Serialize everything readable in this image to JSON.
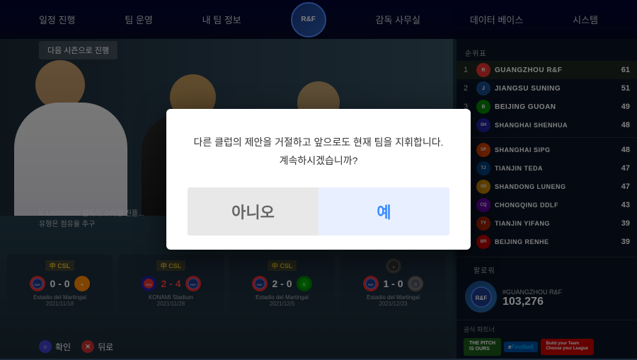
{
  "nav": {
    "items": [
      {
        "id": "schedule",
        "label": "일정 진행",
        "active": false
      },
      {
        "id": "team",
        "label": "팀 운영",
        "active": false
      },
      {
        "id": "team-info",
        "label": "내 팀 정보",
        "active": false
      },
      {
        "id": "manager",
        "label": "감독 사무실",
        "active": false
      },
      {
        "id": "database",
        "label": "데이터 베이스",
        "active": false
      },
      {
        "id": "system",
        "label": "시스템",
        "active": false
      }
    ],
    "logo": "R&F"
  },
  "season_btn": "다음 시즌으로 진행",
  "caption": {
    "line1": "F. LAMPARD 감독이 수비형 진플...",
    "line2": "유형은 점유율 추구"
  },
  "rankings": {
    "label": "순위표",
    "items": [
      {
        "rank": 1,
        "name": "GUANGZHOU R&F",
        "points": 61,
        "color": "#e83030"
      },
      {
        "rank": 2,
        "name": "JIANGSU SUNING",
        "points": 51,
        "color": "#1a4a8a"
      },
      {
        "rank": 3,
        "name": "BEIJING GUOAN",
        "points": 49,
        "color": "#008800"
      },
      {
        "rank": 4,
        "name": "SHANGHAI SHENHUA",
        "points": 48,
        "color": "#2222aa"
      },
      {
        "rank": 5,
        "name": "SHANGHAI SIPG",
        "points": 48,
        "color": "#dd4400"
      },
      {
        "rank": 6,
        "name": "TIANJIN TEDA",
        "points": 47,
        "color": "#004488"
      },
      {
        "rank": 7,
        "name": "SHANDONG LUNENG",
        "points": 47,
        "color": "#cc8800"
      },
      {
        "rank": 8,
        "name": "CHONGQING DDLF",
        "points": 43,
        "color": "#6600aa"
      },
      {
        "rank": 9,
        "name": "TIANJIN YIFANG",
        "points": 39,
        "color": "#aa2200"
      },
      {
        "rank": 10,
        "name": "BEIJING RENHE",
        "points": 39,
        "color": "#cc0000"
      }
    ]
  },
  "follower": {
    "label": "팔로워",
    "team_tag": "#GUANGZHOU R&F",
    "count": "103,276"
  },
  "partners": {
    "label": "공식 파트너",
    "items": [
      {
        "name": "THE PITCH IS OURS",
        "class": "partner-pitch"
      },
      {
        "name": "eFootball",
        "class": "partner-efootball"
      },
      {
        "name": "Build your Team Choose your League",
        "class": "partner-konami"
      }
    ]
  },
  "match_cards": [
    {
      "league": "CSL",
      "home_team": "R&F",
      "home_score": "0",
      "away_score": "0",
      "away_team": "OPP",
      "venue": "Estadio del Martingal",
      "date": "2021/11/18",
      "home_color": "#e83030",
      "away_color": "#ff8800"
    },
    {
      "league": "CSL",
      "home_team": "SHN",
      "home_score": "2",
      "away_score": "4",
      "away_team": "R&F",
      "venue": "KONAMI Stadium",
      "date": "2021/11/28",
      "home_color": "#2222aa",
      "away_color": "#e83030"
    },
    {
      "league": "CSL",
      "home_team": "R&F",
      "home_score": "2",
      "away_score": "0",
      "away_team": "OPP2",
      "venue": "Estadio del Martingal",
      "date": "2021/12/5",
      "home_color": "#e83030",
      "away_color": "#008800"
    },
    {
      "league": "OTHER",
      "home_team": "R&F",
      "home_score": "1",
      "away_score": "0",
      "away_team": "OPP3",
      "venue": "Estadio del Martingal",
      "date": "2021/12/23",
      "home_color": "#e83030",
      "away_color": "#666666"
    }
  ],
  "controls": [
    {
      "label": "확인",
      "btn_class": "btn-confirm",
      "symbol": "○"
    },
    {
      "label": "뒤로",
      "btn_class": "btn-back",
      "symbol": "✕"
    }
  ],
  "modal": {
    "message_line1": "다른 클럽의 제안을 거절하고 앞으로도 현재 팀을 지휘합니다.",
    "message_line2": "계속하시겠습니까?",
    "btn_no": "아니오",
    "btn_yes": "예"
  }
}
